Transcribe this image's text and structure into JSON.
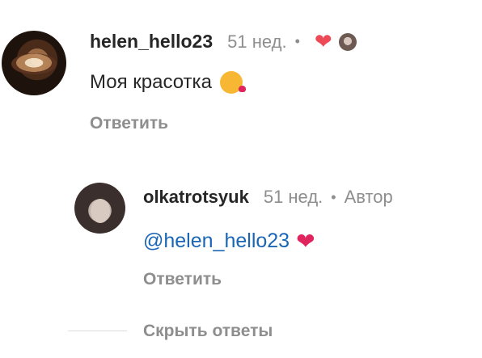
{
  "comment": {
    "username": "helen_hello23",
    "time": "51 нед.",
    "text": "Моя красотка",
    "reply_label": "Ответить",
    "icons": {
      "liked": "heart-filled-icon",
      "emoji": "kissing-face-icon"
    }
  },
  "reply": {
    "username": "olkatrotsyuk",
    "time": "51 нед.",
    "author_badge": "Автор",
    "mention": "@helen_hello23",
    "reply_label": "Ответить",
    "icons": {
      "emoji": "red-heart-icon"
    }
  },
  "hide_replies_label": "Скрыть ответы",
  "colors": {
    "username": "#262626",
    "meta": "#8e8e8e",
    "mention": "#1a66b5",
    "heart": "#ed4956",
    "divider": "#dbdbdb"
  }
}
